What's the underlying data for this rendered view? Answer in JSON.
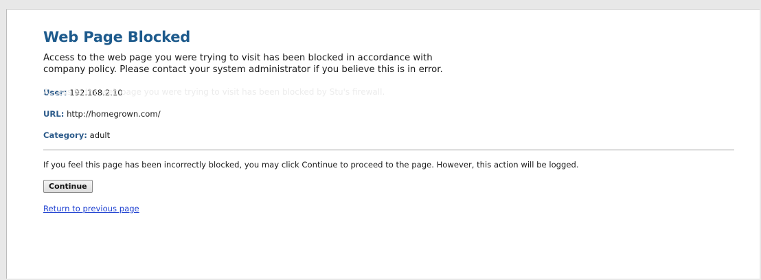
{
  "page": {
    "title": "Web Page Blocked",
    "message": "Access to the web page you were trying to visit has been blocked in accordance with company policy. Please contact your system administrator if you believe this is in error.",
    "ghost_text": "Access to the web page you were trying to visit has been blocked by Stu's firewall."
  },
  "info": {
    "user_label": "User:",
    "user_value": "192.168.2.10",
    "url_label": "URL:",
    "url_value": "http://homegrown.com/",
    "category_label": "Category:",
    "category_value": "adult"
  },
  "notice": "If you feel this page has been incorrectly blocked, you may click Continue to proceed to the page. However, this action will be logged.",
  "actions": {
    "continue_label": "Continue",
    "return_label": "Return to previous page"
  },
  "colors": {
    "title": "#1d5a8c",
    "label": "#2b5a8a",
    "link": "#1a3dd0"
  }
}
